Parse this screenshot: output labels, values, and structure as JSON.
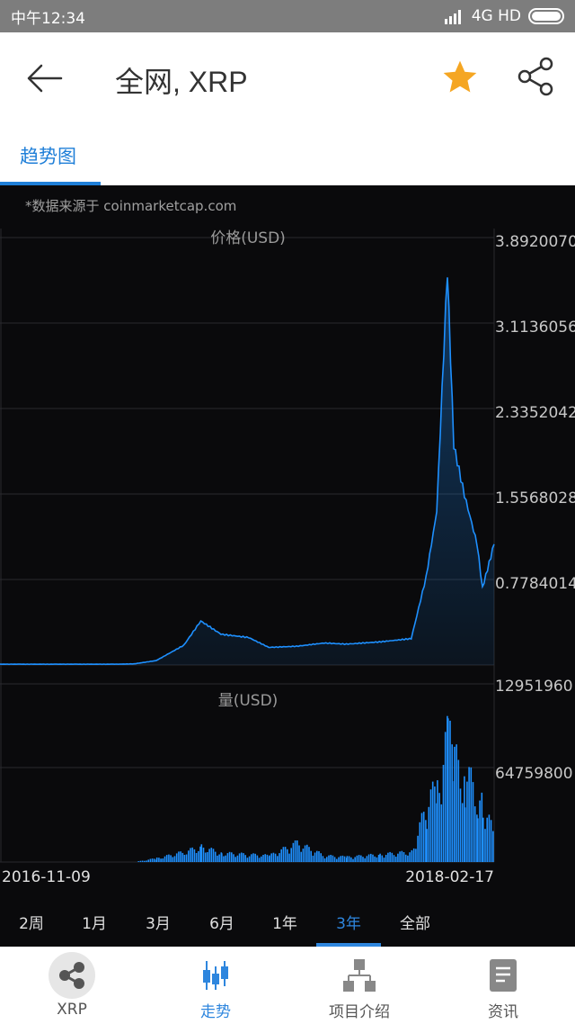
{
  "status_bar": {
    "time": "中午12:34",
    "network": "4G HD"
  },
  "header": {
    "title": "全网, XRP"
  },
  "tabs": [
    {
      "label": "趋势图",
      "active": true
    }
  ],
  "chart": {
    "source_note": "*数据来源于 coinmarketcap.com",
    "price_label": "价格(USD)",
    "volume_label": "量(USD)",
    "price_ticks": [
      "3.8920070",
      "3.1136056",
      "2.3352042",
      "1.5568028",
      "0.7784014"
    ],
    "volume_ticks": [
      "12951960",
      "64759800"
    ],
    "start_date": "2016-11-09",
    "end_date": "2018-02-17"
  },
  "chart_data": {
    "type": "line",
    "title": "",
    "ylabel": "价格(USD)",
    "ylim": [
      0,
      3.892007
    ],
    "x": [
      "2016-11-09",
      "2016-12-15",
      "2017-01-20",
      "2017-02-25",
      "2017-03-15",
      "2017-04-05",
      "2017-05-01",
      "2017-05-17",
      "2017-06-05",
      "2017-07-01",
      "2017-07-20",
      "2017-08-15",
      "2017-09-10",
      "2017-10-01",
      "2017-11-01",
      "2017-12-01",
      "2017-12-15",
      "2017-12-25",
      "2018-01-04",
      "2018-01-10",
      "2018-01-20",
      "2018-02-01",
      "2018-02-06",
      "2018-02-17"
    ],
    "series": [
      {
        "name": "",
        "values": [
          0.007,
          0.007,
          0.007,
          0.007,
          0.01,
          0.04,
          0.18,
          0.4,
          0.28,
          0.25,
          0.16,
          0.17,
          0.2,
          0.19,
          0.21,
          0.24,
          0.8,
          1.4,
          3.6,
          2.0,
          1.55,
          1.1,
          0.7,
          1.1
        ]
      }
    ],
    "volume": {
      "ylabel": "量(USD)",
      "values": [
        0,
        0,
        0,
        0,
        0,
        3,
        8,
        12,
        7,
        6,
        5,
        15,
        5,
        4,
        6,
        8,
        45,
        60,
        100,
        80,
        70,
        55,
        45,
        20
      ]
    }
  },
  "ranges": [
    {
      "label": "2周",
      "active": false
    },
    {
      "label": "1月",
      "active": false
    },
    {
      "label": "3月",
      "active": false
    },
    {
      "label": "6月",
      "active": false
    },
    {
      "label": "1年",
      "active": false
    },
    {
      "label": "3年",
      "active": true
    },
    {
      "label": "全部",
      "active": false
    }
  ],
  "bottom_nav": [
    {
      "label": "XRP",
      "icon": "xrp-logo-icon",
      "active": false
    },
    {
      "label": "走势",
      "icon": "candlestick-icon",
      "active": true
    },
    {
      "label": "项目介绍",
      "icon": "hierarchy-icon",
      "active": false
    },
    {
      "label": "资讯",
      "icon": "document-icon",
      "active": false
    }
  ],
  "colors": {
    "accent": "#2e86de",
    "star": "#f5a623",
    "chart_bg": "#0a0a0c",
    "line": "#1e90ff"
  }
}
